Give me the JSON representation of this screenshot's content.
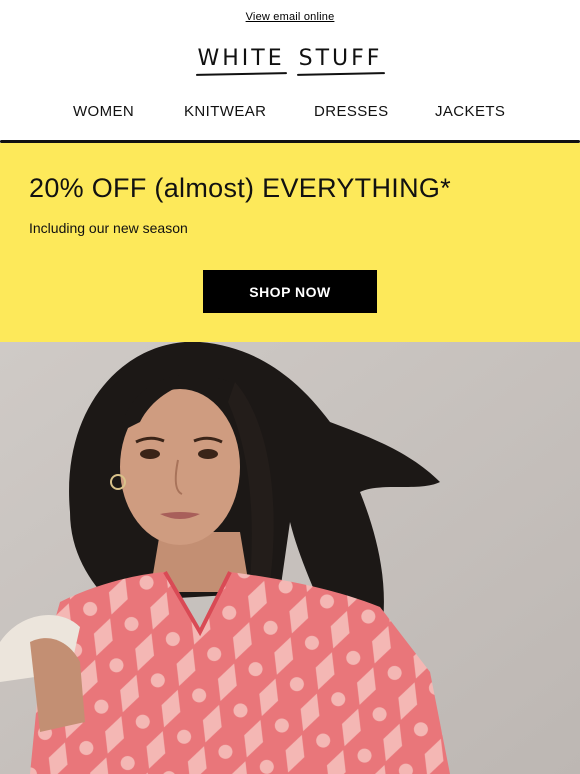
{
  "header": {
    "view_online_label": "View email online",
    "logo_word_1": "WHITE",
    "logo_word_2": "STUFF"
  },
  "nav": {
    "items": [
      {
        "label": "WOMEN"
      },
      {
        "label": "KNITWEAR"
      },
      {
        "label": "DRESSES"
      },
      {
        "label": "JACKETS"
      }
    ]
  },
  "promo": {
    "title": "20% OFF (almost) EVERYTHING*",
    "subtitle": "Including our new season",
    "cta_label": "SHOP NOW",
    "background_color": "#fde95a"
  },
  "hero": {
    "image_icon": "model-photo"
  }
}
